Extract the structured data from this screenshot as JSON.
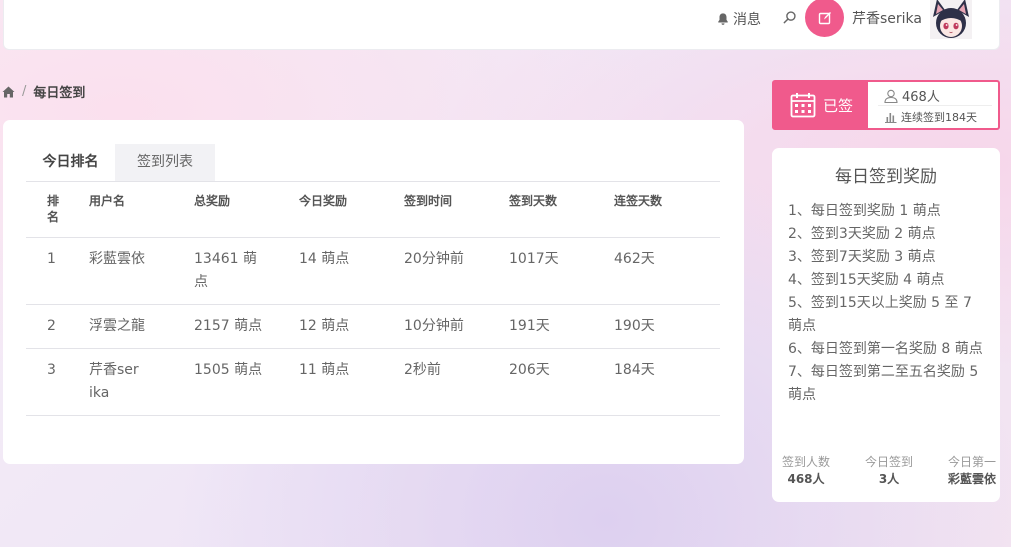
{
  "header": {
    "notice_label": "消息",
    "username": "芹香serika",
    "accent_color": "#f05a8c"
  },
  "breadcrumb": {
    "current": "每日签到"
  },
  "tabs": [
    {
      "label": "今日排名",
      "active": true
    },
    {
      "label": "签到列表",
      "active": false
    }
  ],
  "table": {
    "headers": [
      "排名",
      "用户名",
      "总奖励",
      "今日奖励",
      "签到时间",
      "签到天数",
      "连签天数"
    ],
    "rows": [
      [
        "1",
        "彩藍雲依",
        "13461 萌点",
        "14 萌点",
        "20分钟前",
        "1017天",
        "462天"
      ],
      [
        "2",
        "浮雲之龍",
        "2157 萌点",
        "12 萌点",
        "10分钟前",
        "191天",
        "190天"
      ],
      [
        "3",
        "芹香serika",
        "1505 萌点",
        "11 萌点",
        "2秒前",
        "206天",
        "184天"
      ]
    ]
  },
  "sign": {
    "status": "已签",
    "count": "468人",
    "streak": "连续签到184天"
  },
  "rewards": {
    "title": "每日签到奖励",
    "rules": [
      "1、每日签到奖励 1 萌点",
      "2、签到3天奖励 2 萌点",
      "3、签到7天奖励 3 萌点",
      "4、签到15天奖励 4 萌点",
      "5、签到15天以上奖励 5 至 7 萌点",
      "6、每日签到第一名奖励 8 萌点",
      "7、每日签到第二至五名奖励 5 萌点"
    ],
    "stats": [
      {
        "label": "签到人数",
        "value": "468人"
      },
      {
        "label": "今日签到",
        "value": "3人"
      },
      {
        "label": "今日第一",
        "value": "彩藍雲依"
      }
    ]
  }
}
